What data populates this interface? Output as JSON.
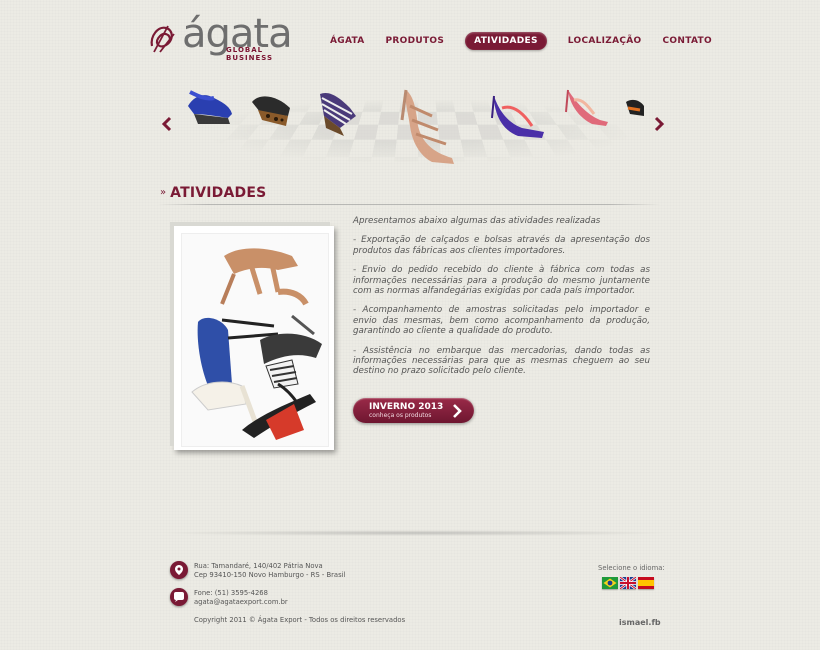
{
  "brand": {
    "name": "ágata",
    "tagline": "GLOBAL BUSINESS",
    "color": "#7a1a35"
  },
  "nav": {
    "items": [
      {
        "label": "ÁGATA",
        "active": false
      },
      {
        "label": "PRODUTOS",
        "active": false
      },
      {
        "label": "ATIVIDADES",
        "active": true
      },
      {
        "label": "LOCALIZAÇÃO",
        "active": false
      },
      {
        "label": "CONTATO",
        "active": false
      }
    ]
  },
  "carousel": {
    "prev_icon": "chevron-left-icon",
    "next_icon": "chevron-right-icon"
  },
  "section": {
    "title": "ATIVIDADES"
  },
  "content": {
    "paragraphs": [
      "Apresentamos abaixo algumas das atividades realizadas",
      "- Exportação de calçados e bolsas através da apresentação dos produtos das fábricas aos clientes importadores.",
      "- Envio do pedido recebido do cliente à fábrica com todas as informações necessárias para a produção do mesmo juntamente com as normas alfandegárias exigidas por cada país importador.",
      "- Acompanhamento de amostras solicitadas pelo importador e envio das mesmas, bem como acompanhamento da produção, garantindo ao cliente a qualidade do produto.",
      "- Assistência no embarque das mercadorias, dando todas as informações necessárias para que as mesmas cheguem ao seu destino no prazo solicitado pelo cliente."
    ]
  },
  "cta": {
    "title": "INVERNO 2013",
    "subtitle": "conheça os produtos"
  },
  "footer": {
    "address_line1": "Rua: Tamandaré, 140/402 Pátria Nova",
    "address_line2": "Cep 93410-150 Novo Hamburgo - RS - Brasil",
    "phone": "Fone: (51) 3595-4268",
    "email": "agata@agataexport.com.br",
    "copyright": "Copyright 2011 © Ágata Export - Todos os direitos reservados",
    "language_label": "Selecione o idioma:",
    "credit": "ismael.fb"
  }
}
